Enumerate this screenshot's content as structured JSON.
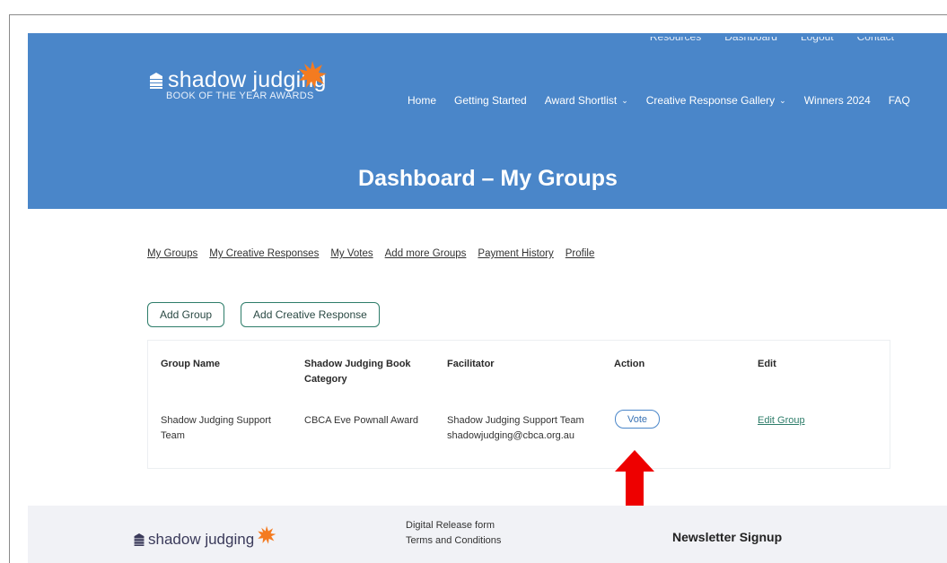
{
  "top_nav": [
    "Resources",
    "Dashboard",
    "Logout",
    "Contact"
  ],
  "logo": {
    "word": "shadow judging",
    "sub": "BOOK OF THE YEAR AWARDS"
  },
  "main_nav": [
    {
      "label": "Home",
      "dropdown": false
    },
    {
      "label": "Getting Started",
      "dropdown": false
    },
    {
      "label": "Award Shortlist",
      "dropdown": true
    },
    {
      "label": "Creative Response Gallery",
      "dropdown": true
    },
    {
      "label": "Winners 2024",
      "dropdown": false
    },
    {
      "label": "FAQ",
      "dropdown": false
    }
  ],
  "page_title": "Dashboard – My Groups",
  "tabs": [
    "My Groups",
    "My Creative Responses",
    "My Votes",
    "Add more Groups",
    "Payment History",
    "Profile"
  ],
  "buttons": {
    "add_group": "Add Group",
    "add_creative_response": "Add Creative Response"
  },
  "table": {
    "headers": {
      "group_name": "Group Name",
      "category_line1": "Shadow Judging Book",
      "category_line2": "Category",
      "facilitator": "Facilitator",
      "action": "Action",
      "edit": "Edit"
    },
    "row": {
      "group_line1": "Shadow Judging Support",
      "group_line2": "Team",
      "category": "CBCA Eve Pownall Award",
      "facilitator_name": "Shadow Judging Support Team",
      "facilitator_email": "shadowjudging@cbca.org.au",
      "action_label": "Vote",
      "edit_label": "Edit Group"
    }
  },
  "footer": {
    "logo_word": "shadow judging",
    "links": [
      "Digital Release form",
      "Terms and Conditions"
    ],
    "newsletter": "Newsletter Signup"
  },
  "colors": {
    "hero": "#4a86c9",
    "accent_orange": "#f47b20",
    "teal": "#2e7d6a",
    "arrow": "#ee0000"
  }
}
